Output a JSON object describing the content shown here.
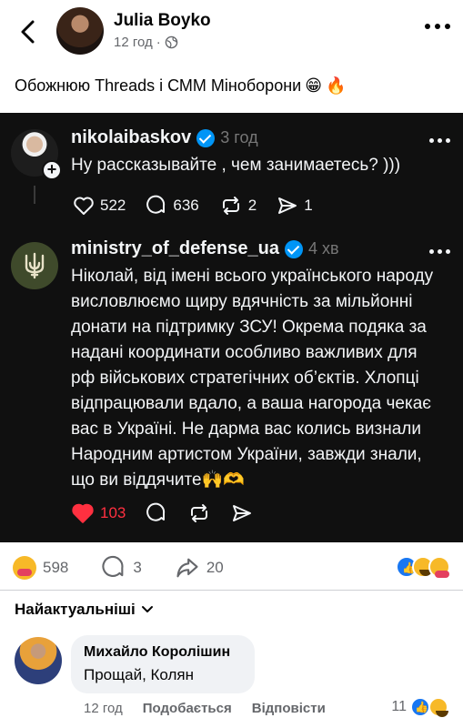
{
  "header": {
    "author": "Julia Boyko",
    "time": "12 год",
    "separator": "·",
    "audience_icon": "globe-icon"
  },
  "post": {
    "text": "Обожнюю Threads і СММ Міноборони",
    "emojis": [
      "😁",
      "🔥"
    ]
  },
  "thread_screenshot": {
    "first": {
      "username": "nikolaibaskov",
      "age": "3 год",
      "text": "Ну рассказывайте , чем занимаетесь? )))",
      "likes": "522",
      "replies": "636",
      "reposts": "2",
      "shares": "1"
    },
    "reply": {
      "username": "ministry_of_defense_ua",
      "age": "4 хв",
      "lines": [
        "Ніколай, від імені всього українського народу",
        "висловлюємо щиру вдячність за мільйонні",
        "донати на підтримку ЗСУ! Окрема подяка за",
        "надані координати особливо важливих для",
        "рф військових стратегічних об’єктів. Хлопці",
        "відпрацювали вдало, а ваша нагорода чекає",
        "вас в Україні. Не дарма вас колись визнали",
        "Народним артистом України, завжди знали,",
        "що ви віддячите🙌🫶"
      ],
      "likes": "103"
    }
  },
  "stats": {
    "reactions": "598",
    "comments": "3",
    "shares": "20"
  },
  "comments_section": {
    "sort_label": "Найактуальніші",
    "comment": {
      "author": "Михайло Королішин",
      "text": "Прощай, Колян",
      "time": "12 год",
      "like_action": "Подобається",
      "reply_action": "Відповісти",
      "reaction_count": "11"
    }
  },
  "colors": {
    "dark_bg": "#101010",
    "verified": "#0095f6",
    "heart": "#ff3040",
    "fb_blue": "#1877f2"
  }
}
